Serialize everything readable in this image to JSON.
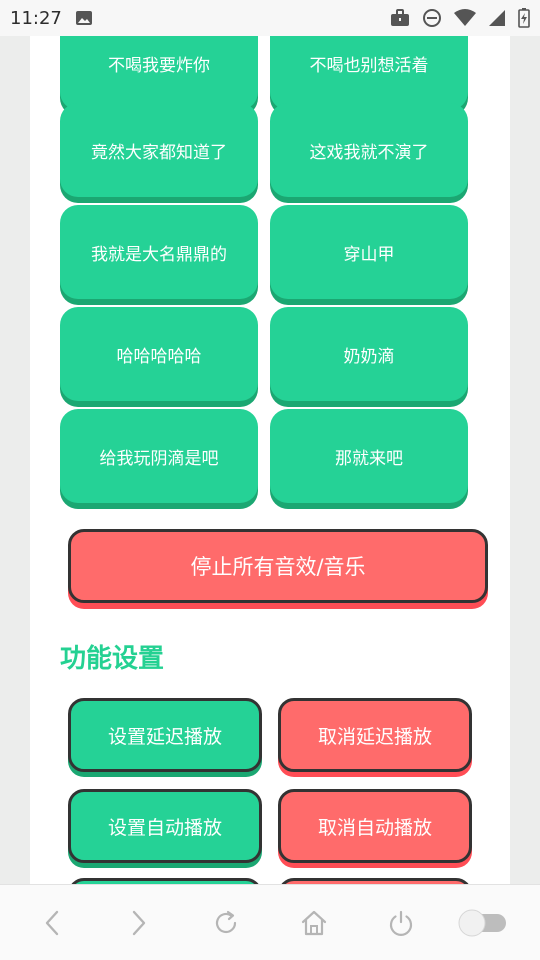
{
  "status_bar": {
    "time": "11:27",
    "icons": [
      "image-icon",
      "briefcase-icon",
      "do-not-disturb-icon",
      "wifi-icon",
      "signal-icon",
      "battery-charging-icon"
    ]
  },
  "sound_buttons": [
    "不喝我要炸你",
    "不喝也别想活着",
    "竟然大家都知道了",
    "这戏我就不演了",
    "我就是大名鼎鼎的",
    "穿山甲",
    "哈哈哈哈哈",
    "奶奶滴",
    "给我玩阴滴是吧",
    "那就来吧"
  ],
  "stop_button": "停止所有音效/音乐",
  "section_title": "功能设置",
  "function_buttons": {
    "set_delay": "设置延迟播放",
    "cancel_delay": "取消延迟播放",
    "set_auto": "设置自动播放",
    "cancel_auto": "取消自动播放"
  },
  "bottom_bar": {
    "icons": [
      "back-icon",
      "forward-icon",
      "reload-icon",
      "home-icon",
      "power-icon",
      "toggle-switch"
    ]
  },
  "colors": {
    "green": "#25d296",
    "red": "#ff6b6b",
    "title_green": "#24d192"
  }
}
